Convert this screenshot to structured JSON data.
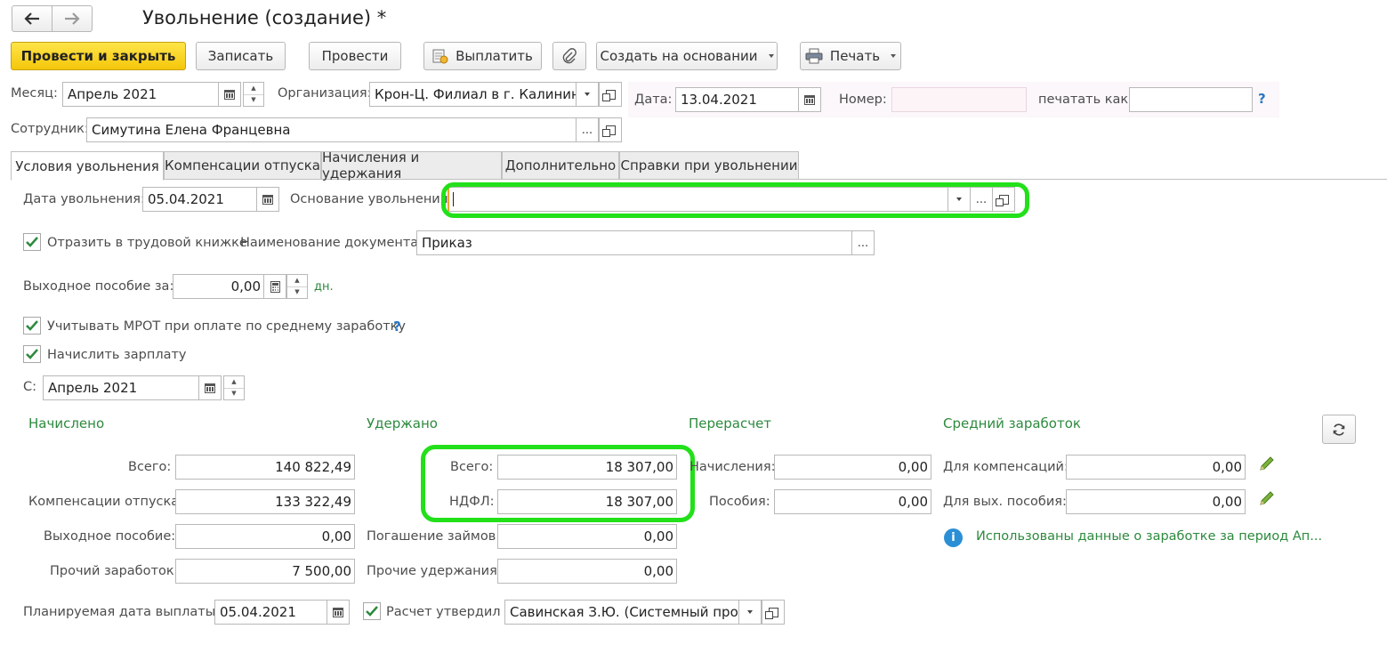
{
  "window": {
    "title": "Увольнение (создание) *"
  },
  "toolbar": {
    "post_close": "Провести и закрыть",
    "write": "Записать",
    "post": "Провести",
    "pay": "Выплатить",
    "create_based": "Создать на основании",
    "print": "Печать"
  },
  "header": {
    "month_label": "Месяц:",
    "month_value": "Апрель 2021",
    "org_label": "Организация:",
    "org_value": "Крон-Ц. Филиал в г. Калининграде",
    "date_label": "Дата:",
    "date_value": "13.04.2021",
    "number_label": "Номер:",
    "number_value": "",
    "print_as_label": "печатать как:",
    "print_as_value": "",
    "help": "?",
    "employee_label": "Сотрудник:",
    "employee_value": "Симутина Елена Францевна"
  },
  "tabs": [
    "Условия увольнения",
    "Компенсации отпуска",
    "Начисления и удержания",
    "Дополнительно",
    "Справки при увольнении"
  ],
  "conditions": {
    "dismissal_date_label": "Дата увольнения:",
    "dismissal_date_value": "05.04.2021",
    "reason_label": "Основание увольнения:",
    "reason_value": "",
    "reflect_label": "Отразить в трудовой книжке",
    "reflect_checked": true,
    "doc_name_label": "Наименование документа:",
    "doc_name_value": "Приказ",
    "severance_label": "Выходное пособие за:",
    "severance_value": "0,00",
    "severance_unit": "дн.",
    "mrot_label": "Учитывать МРОТ при оплате по среднему заработку",
    "mrot_checked": true,
    "mrot_help": "?",
    "salary_label": "Начислить зарплату",
    "salary_checked": true,
    "from_label": "С:",
    "from_value": "Апрель 2021"
  },
  "accrued": {
    "title": "Начислено",
    "rows": [
      {
        "label": "Всего:",
        "value": "140 822,49"
      },
      {
        "label": "Компенсации отпуска:",
        "value": "133 322,49"
      },
      {
        "label": "Выходное пособие:",
        "value": "0,00"
      },
      {
        "label": "Прочий заработок:",
        "value": "7 500,00"
      }
    ]
  },
  "withheld": {
    "title": "Удержано",
    "rows": [
      {
        "label": "Всего:",
        "value": "18 307,00"
      },
      {
        "label": "НДФЛ:",
        "value": "18 307,00"
      },
      {
        "label": "Погашение займов:",
        "value": "0,00"
      },
      {
        "label": "Прочие удержания:",
        "value": "0,00"
      }
    ]
  },
  "recalc": {
    "title": "Перерасчет",
    "rows": [
      {
        "label": "Начисления:",
        "value": "0,00"
      },
      {
        "label": "Пособия:",
        "value": "0,00"
      }
    ]
  },
  "avg": {
    "title": "Средний заработок",
    "rows": [
      {
        "label": "Для компенсаций:",
        "value": "0,00"
      },
      {
        "label": "Для вых. пособия:",
        "value": "0,00"
      }
    ],
    "info": "Использованы данные о заработке за период Ап..."
  },
  "footer": {
    "pay_date_label": "Планируемая дата выплаты:",
    "pay_date_value": "05.04.2021",
    "approved_label": "Расчет утвердил",
    "approved_checked": true,
    "approver_value": "Савинская З.Ю. (Системный программист)"
  },
  "colors": {
    "accent_green": "#2d8a3e",
    "highlight_ring": "#22e019",
    "primary_button": "#f4c60b",
    "help_blue": "#2b77c4"
  },
  "icons": [
    "back-arrow-icon",
    "forward-arrow-icon",
    "pay-icon",
    "paperclip-icon",
    "printer-icon",
    "calendar-icon",
    "open-icon",
    "ellipsis-icon",
    "refresh-icon",
    "pencil-icon",
    "info-icon",
    "checkmark-icon"
  ]
}
